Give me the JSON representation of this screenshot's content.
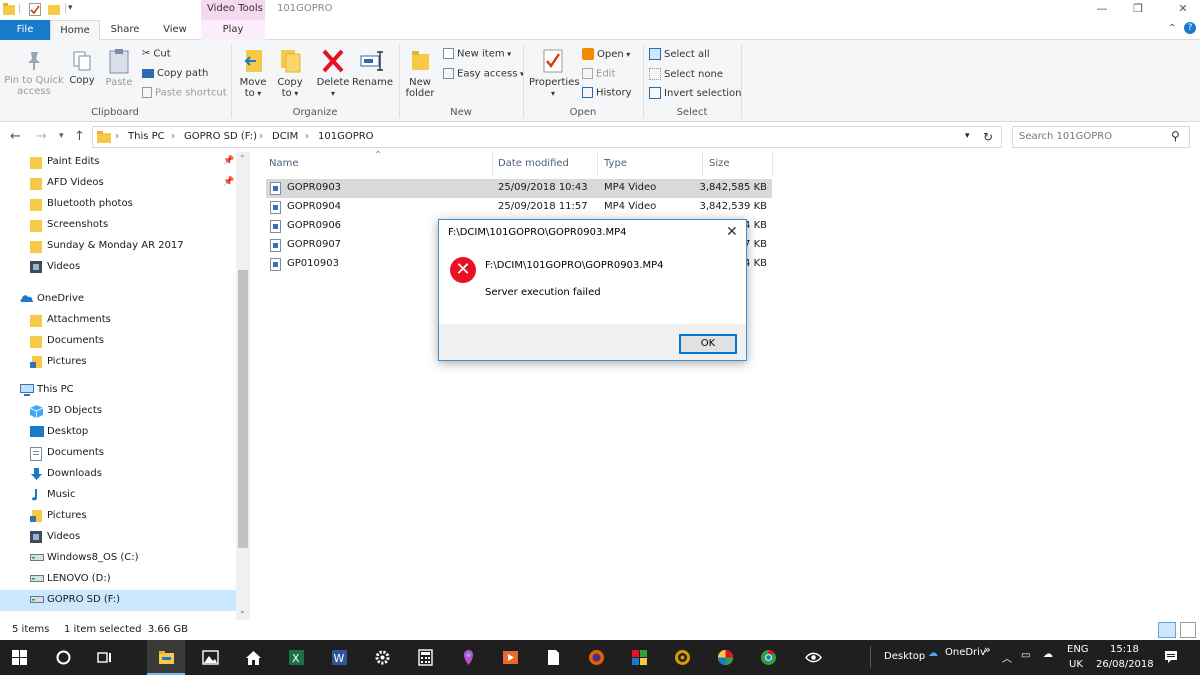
{
  "window": {
    "context_tab": "Video Tools",
    "title": "101GOPRO"
  },
  "tabs": [
    "File",
    "Home",
    "Share",
    "View",
    "Play"
  ],
  "ribbon": {
    "clipboard": {
      "pin_label": "Pin to Quick access",
      "copy_label": "Copy",
      "paste_label": "Paste",
      "cut_label": "Cut",
      "copy_path_label": "Copy path",
      "paste_shortcut_label": "Paste shortcut",
      "group_label": "Clipboard"
    },
    "organize": {
      "move_to_label": "Move to",
      "copy_to_label": "Copy to",
      "delete_label": "Delete",
      "rename_label": "Rename",
      "group_label": "Organize"
    },
    "new": {
      "new_folder_label": "New folder",
      "new_item_label": "New item",
      "easy_access_label": "Easy access",
      "group_label": "New"
    },
    "open": {
      "properties_label": "Properties",
      "open_label": "Open",
      "edit_label": "Edit",
      "history_label": "History",
      "group_label": "Open"
    },
    "select": {
      "select_all_label": "Select all",
      "select_none_label": "Select none",
      "invert_label": "Invert selection",
      "group_label": "Select"
    }
  },
  "address": {
    "crumbs": [
      "This PC",
      "GOPRO SD (F:)",
      "DCIM",
      "101GOPRO"
    ],
    "search_placeholder": "Search 101GOPRO"
  },
  "nav_items": [
    {
      "label": "Paint Edits",
      "icon": "folder-icon",
      "pinned": true
    },
    {
      "label": "AFD Videos",
      "icon": "folder-icon",
      "pinned": true
    },
    {
      "label": "Bluetooth photos",
      "icon": "folder-icon"
    },
    {
      "label": "Screenshots",
      "icon": "folder-icon"
    },
    {
      "label": "Sunday & Monday AR 2017",
      "icon": "folder-icon"
    },
    {
      "label": "Videos",
      "icon": "videos-icon"
    },
    {
      "label": "OneDrive",
      "icon": "onedrive-icon"
    },
    {
      "label": "Attachments",
      "icon": "folder-icon"
    },
    {
      "label": "Documents",
      "icon": "folder-icon"
    },
    {
      "label": "Pictures",
      "icon": "pictures-icon"
    },
    {
      "label": "This PC",
      "icon": "computer-icon"
    },
    {
      "label": "3D Objects",
      "icon": "3d-objects-icon"
    },
    {
      "label": "Desktop",
      "icon": "desktop-icon"
    },
    {
      "label": "Documents",
      "icon": "documents-icon"
    },
    {
      "label": "Downloads",
      "icon": "downloads-icon"
    },
    {
      "label": "Music",
      "icon": "music-icon"
    },
    {
      "label": "Pictures",
      "icon": "pictures-icon"
    },
    {
      "label": "Videos",
      "icon": "videos-icon"
    },
    {
      "label": "Windows8_OS (C:)",
      "icon": "drive-icon"
    },
    {
      "label": "LENOVO (D:)",
      "icon": "drive-icon"
    },
    {
      "label": "GOPRO SD (F:)",
      "icon": "drive-icon",
      "selected": true
    }
  ],
  "columns": {
    "name": "Name",
    "date": "Date modified",
    "type": "Type",
    "size": "Size"
  },
  "files": [
    {
      "name": "GOPR0903",
      "date": "25/09/2018 10:43",
      "type": "MP4 Video",
      "size": "3,842,585 KB",
      "selected": true
    },
    {
      "name": "GOPR0904",
      "date": "25/09/2018 11:57",
      "type": "MP4 Video",
      "size": "3,842,539 KB"
    },
    {
      "name": "GOPR0906",
      "date": "",
      "type": "",
      "size": "4 KB"
    },
    {
      "name": "GOPR0907",
      "date": "",
      "type": "",
      "size": "7 KB"
    },
    {
      "name": "GP010903",
      "date": "",
      "type": "",
      "size": "4 KB"
    }
  ],
  "status": {
    "items": "5 items",
    "selection": "1 item selected  3.66 GB"
  },
  "dialog": {
    "title": "F:\\DCIM\\101GOPRO\\GOPR0903.MP4",
    "path": "F:\\DCIM\\101GOPRO\\GOPR0903.MP4",
    "message": "Server execution failed",
    "ok_label": "OK"
  },
  "taskbar": {
    "desktop_label": "Desktop",
    "onedrive_label": "OneDriv",
    "lang_top": "ENG",
    "lang_bottom": "UK",
    "time": "15:18",
    "date": "26/08/2018"
  },
  "colors": {
    "accent": "#1979ca",
    "selection": "#cce8ff",
    "error": "#e81123",
    "taskbar": "#1f1f1f"
  }
}
